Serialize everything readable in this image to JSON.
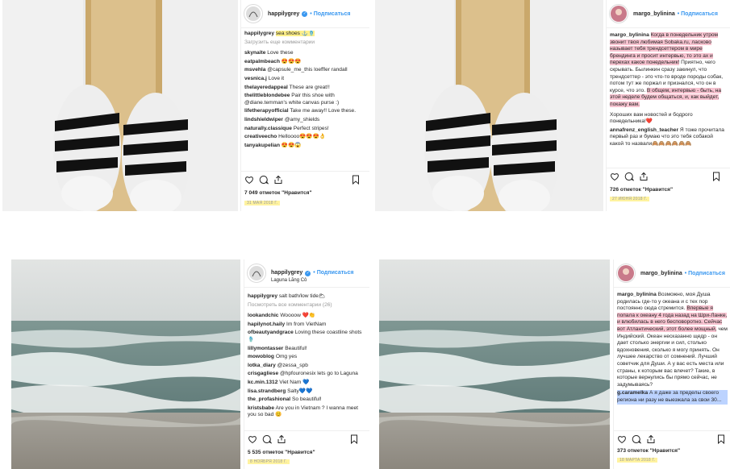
{
  "posts": [
    {
      "username": "happilygrey",
      "follow": "• Подписаться",
      "caption_user": "happilygrey",
      "caption_text": "sea shoes ⚓🩴",
      "load_more": "Загрузить еще комментарии",
      "comments": [
        {
          "user": "skynaite",
          "text": "Love these"
        },
        {
          "user": "eatpalmbeach",
          "text": "😍😍😍"
        },
        {
          "user": "msvehla",
          "text": "@capsule_me_this loeffler randall"
        },
        {
          "user": "vesnica.j",
          "text": "Love it"
        },
        {
          "user": "thelayeredappeal",
          "text": "These are great!!"
        },
        {
          "user": "thelittleblondebee",
          "text": "Pair this shoe with @diane.temman's white canvas purse :)"
        },
        {
          "user": "lifetherapyofficial",
          "text": "Take me away!! Love these."
        },
        {
          "user": "lindshieldwiper",
          "text": "@amy_shields"
        },
        {
          "user": "naturally.classique",
          "text": "Perfect stripes!"
        },
        {
          "user": "creativeecho",
          "text": "Helloooo😍😍😍👌"
        },
        {
          "user": "tanyakupelian",
          "text": "😍😍😱"
        }
      ],
      "likes": "7 049 отметок \"Нравится\"",
      "date": "31 МАЯ 2018 Г."
    },
    {
      "username": "margo_bylinina",
      "follow": "• Подписаться",
      "caption_user": "margo_bylinina",
      "caption_hl": "Когда в понедельник утром звонит твоя любимая Sobaka.ru, ласково называет тебя трендсеттером в мире брендинга и просит интервью, то это ах и перехах какое понедельник!",
      "caption_text": "Приятно, чего скрывать. Былинкин сразу закинул, что трендсеттер - это что-то вроде породы собак, потом тут же поржал и признался, что он в курсе, что это.",
      "caption_tail": "В общем, интервью - быть, на этой неделе будем общаться, и, как выйдет, покажу вам.",
      "caption_end": "Хороших вам новостей и бодрого понедельника!❤️",
      "comments": [
        {
          "user": "annafrenz_english_teacher",
          "text": "Я тоже прочитала первый раз и бумаю что это тебя собакой какой то назвали🙈🙈🙈🙈🙈🙈"
        }
      ],
      "likes": "726 отметок \"Нравится\"",
      "date": "27 ИЮНЯ 2018 Г."
    },
    {
      "username": "happilygrey",
      "follow": "• Подписаться",
      "location": "Laguna Lăng Cô",
      "caption_user": "happilygrey",
      "caption_text": "salt bath/low tide🌥",
      "load_more": "Посмотреть все комментарии (26)",
      "comments": [
        {
          "user": "lookandchic",
          "text": "Woooow ❤️👏"
        },
        {
          "user": "hapilynot.haily",
          "text": "Im from VietNam"
        },
        {
          "user": "ofbeautyandgrace",
          "text": "Loving these coastline shots 🩴"
        },
        {
          "user": "lillymontasser",
          "text": "Beautiful!"
        },
        {
          "user": "mowoblog",
          "text": "Omg yes"
        },
        {
          "user": "lotka_diary",
          "text": "@zessa_spb"
        },
        {
          "user": "crisgagliese",
          "text": "@hpfouronesix lets go to Laguna"
        },
        {
          "user": "kc.min.1312",
          "text": "Viet Nam 💙"
        },
        {
          "user": "lisa.strandberg",
          "text": "Salty💙💙"
        },
        {
          "user": "the_profashional",
          "text": "So beautiful!"
        },
        {
          "user": "kristsbabe",
          "text": "Are you in Vietnam ? I wanna meet you so bad 😊"
        }
      ],
      "likes": "5 535 отметок \"Нравится\"",
      "date": "8 НОЯБРЯ 2018 Г."
    },
    {
      "username": "margo_bylinina",
      "follow": "• Подписаться",
      "caption_user": "margo_bylinina",
      "caption_text": "Возможно, моя Душа родилась где-то у океана и с тех пор постоянно сюда стремится.",
      "caption_hl": "Впервые я попала к океану 4 года назад на Шри-Ланке, и влюбилась в него бесповоротно. Сейчас вот Атлантический, этот более мощный,",
      "caption_rest": "чем Индийский. Океан несказанно щедр - он дает столько энергии и сил, столько вдохновения, сколько я могу принять. Он лучшее лекарство от сомнений. Лучший советчик для Души. А у вас есть места или страны, к которым вас влечет? Такие, в которые вернулись бы прямо сейчас, не задумываясь?",
      "comments": [
        {
          "user": "g.caramelka",
          "text": "А я даже за пределы своего региона ни разу не выезжала за свои 30..."
        }
      ],
      "likes": "373 отметок \"Нравится\"",
      "date": "18 МАРТА 2018 Г."
    }
  ]
}
